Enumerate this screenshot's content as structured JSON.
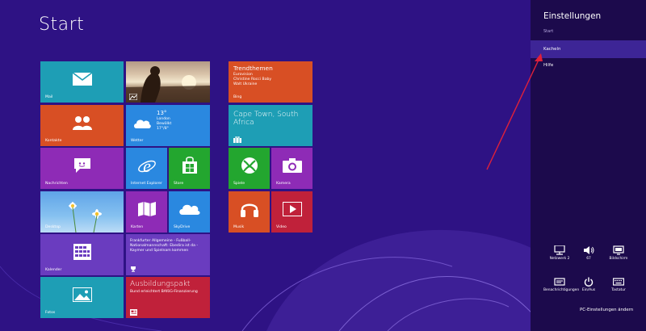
{
  "start": {
    "title": "Start"
  },
  "tiles": {
    "mail": {
      "label": "Mail",
      "color": "#1e9eb5"
    },
    "photo": {
      "label": ""
    },
    "trend": {
      "title": "Trendthemen",
      "lines": [
        "Eurovision",
        "Christine Rocci Baby",
        "Walt Ukraine"
      ],
      "label": "Bing",
      "color": "#d84f24"
    },
    "kontakte": {
      "label": "Kontakte",
      "color": "#d84f24"
    },
    "wetter": {
      "temp": "13°",
      "city": "London",
      "cond": "Bewölkt",
      "range": "17°/8°",
      "label": "Wetter",
      "color": "#2a88e0"
    },
    "cape": {
      "title": "Cape Town, South Africa",
      "color": "#1e9eb5"
    },
    "nachrichten": {
      "label": "Nachrichten",
      "color": "#8e2bb6"
    },
    "ie": {
      "label": "Internet Explorer",
      "color": "#2a88e0"
    },
    "store": {
      "label": "Store",
      "color": "#23a62f"
    },
    "spiele": {
      "label": "Spiele",
      "color": "#23a62f"
    },
    "kamera": {
      "label": "Kamera",
      "color": "#8e2bb6"
    },
    "desktop": {
      "label": "Desktop"
    },
    "karten": {
      "label": "Karten",
      "color": "#8e2bb6"
    },
    "skydrive": {
      "label": "SkyDrive",
      "color": "#2a88e0"
    },
    "musik": {
      "label": "Musik",
      "color": "#d84f24"
    },
    "video": {
      "label": "Video",
      "color": "#c0213a"
    },
    "kalender": {
      "label": "Kalender",
      "color": "#6a3cbf"
    },
    "faz": {
      "text": "Frankfurter Allgemeine - Fußball-Nationalmannschaft: Ebedira ist da - Kaymer und Spielnam kommen",
      "color": "#6a3cbf"
    },
    "fotos": {
      "label": "Fotos",
      "color": "#1e9eb5"
    },
    "ausbildung": {
      "title": "Ausbildungspakt",
      "text": "Bund erleichtert BAföG-Finanzierung",
      "color": "#c0213a"
    }
  },
  "charm": {
    "title": "Einstellungen",
    "subtitle": "Start",
    "items": [
      "Kacheln",
      "Hilfe"
    ],
    "quick": [
      {
        "icon": "network-icon",
        "label": "Netzwerk 2"
      },
      {
        "icon": "volume-icon",
        "label": "67"
      },
      {
        "icon": "screen-icon",
        "label": "Bildschirm"
      },
      {
        "icon": "notifications-icon",
        "label": "Benachrichtigungen"
      },
      {
        "icon": "power-icon",
        "label": "Ein/Aus"
      },
      {
        "icon": "keyboard-icon",
        "label": "Tastatur"
      }
    ],
    "pc_settings": "PC-Einstellungen ändern",
    "accent": "#3d2596"
  }
}
